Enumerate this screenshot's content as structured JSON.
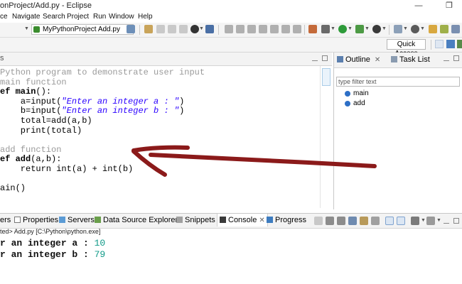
{
  "window": {
    "title": "onProject/Add.py - Eclipse",
    "controls": [
      "minimize-icon",
      "maximize-icon"
    ]
  },
  "menu": [
    "ce",
    "Navigate",
    "Search",
    "Project",
    "Run",
    "Window",
    "Help"
  ],
  "toolbar": {
    "run_config_label": "MyPythonProject Add.py",
    "icons": [
      "new-icon",
      "save-icon",
      "debug-icon",
      "run-icon",
      "search-icon",
      "terminal-icon",
      "open-type-icon",
      "next-annotation-icon",
      "back-icon",
      "forward-icon"
    ]
  },
  "quick_access": {
    "label": "Quick Access"
  },
  "editor": {
    "tab_fragment": "s",
    "lines": [
      {
        "kind": "comment",
        "text": "Python program to demonstrate user input"
      },
      {
        "kind": "comment",
        "text": "main function"
      },
      {
        "kind": "def",
        "prefix": "ef ",
        "name": "main",
        "rest": "():"
      },
      {
        "kind": "call_str",
        "indent": "    ",
        "before": "a=input(",
        "str": "\"Enter an integer a : \"",
        "after": ")"
      },
      {
        "kind": "call_str",
        "indent": "    ",
        "before": "b=input(",
        "str": "\"Enter an integer b : \"",
        "after": ")"
      },
      {
        "kind": "plain",
        "text": "    total=add(a,b)"
      },
      {
        "kind": "plain",
        "text": "    print(total)"
      },
      {
        "kind": "blank",
        "text": ""
      },
      {
        "kind": "comment",
        "text": "add function"
      },
      {
        "kind": "def",
        "prefix": "ef ",
        "name": "add",
        "rest": "(a,b):"
      },
      {
        "kind": "plain",
        "text": "    return int(a) + int(b)"
      },
      {
        "kind": "blank",
        "text": ""
      },
      {
        "kind": "plain",
        "text": "ain()"
      }
    ]
  },
  "outline": {
    "tabs": [
      {
        "label": "Outline",
        "icon": "outline-icon",
        "closable": true
      },
      {
        "label": "Task List",
        "icon": "task-list-icon",
        "closable": false
      }
    ],
    "filter_placeholder": "type filter text",
    "items": [
      "main",
      "add"
    ]
  },
  "bottom_tabs": [
    {
      "label": "ers",
      "icon": ""
    },
    {
      "label": "Properties",
      "icon": "properties-icon"
    },
    {
      "label": "Servers",
      "icon": "servers-icon"
    },
    {
      "label": "Data Source Explorer",
      "icon": "data-source-icon"
    },
    {
      "label": "Snippets",
      "icon": "snippets-icon"
    },
    {
      "label": "Console",
      "icon": "console-icon",
      "active": true
    },
    {
      "label": "Progress",
      "icon": "progress-icon"
    }
  ],
  "console": {
    "status": "ted> Add.py [C:\\Python\\python.exe]",
    "lines": [
      {
        "prompt": "r an integer a : ",
        "input": "10"
      },
      {
        "prompt": "r an integer b : ",
        "input": "79"
      }
    ]
  },
  "colors": {
    "annotation_arrow": "#8b1a1a",
    "string_literal": "#2a00ff",
    "comment": "#9a9a9a",
    "console_input": "#109a88"
  }
}
